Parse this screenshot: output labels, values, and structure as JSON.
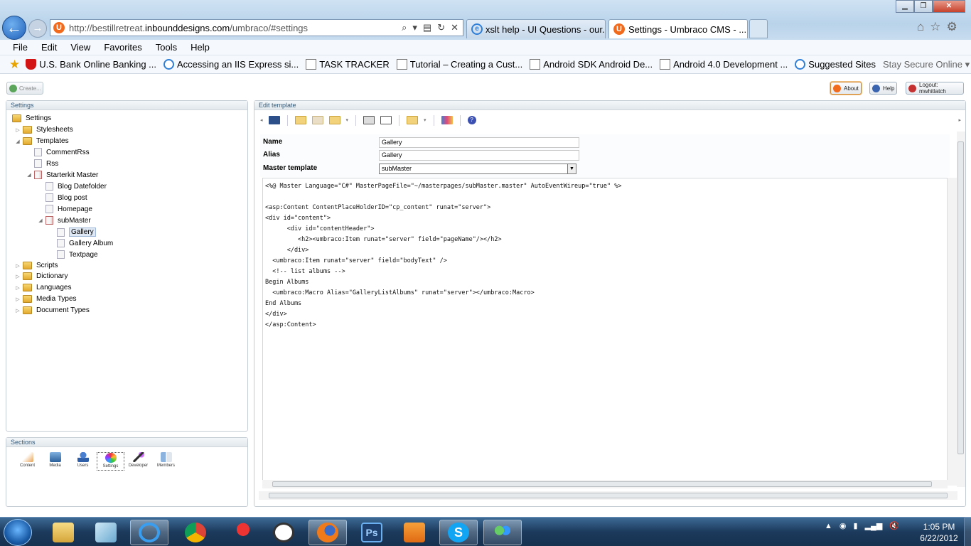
{
  "browser": {
    "address": {
      "prefix": "http://bestillretreat.",
      "domain": "inbounddesigns.com",
      "path": "/umbraco/#settings"
    },
    "tabs": [
      {
        "label": "xslt help - UI Questions - our.u..."
      },
      {
        "label": "Settings - Umbraco CMS - ..."
      }
    ],
    "menu": [
      "File",
      "Edit",
      "View",
      "Favorites",
      "Tools",
      "Help"
    ],
    "favorites": [
      "U.S. Bank Online Banking ...",
      "Accessing an IIS Express si...",
      "TASK TRACKER",
      "Tutorial – Creating a Cust...",
      "Android SDK  Android De...",
      "Android 4.0 Development ...",
      "Suggested Sites",
      "Stay Secure Online"
    ]
  },
  "umbraco": {
    "create_label": "Create...",
    "about_label": "About",
    "help_label": "Help",
    "logout_label": "Logout: mwhitlatch",
    "settings_title": "Settings",
    "sections_title": "Sections",
    "edit_title": "Edit template",
    "tree": {
      "root": "Settings",
      "stylesheets": "Stylesheets",
      "templates": "Templates",
      "commentrss": "CommentRss",
      "rss": "Rss",
      "starterkit": "Starterkit Master",
      "blog_datefolder": "Blog Datefolder",
      "blog_post": "Blog post",
      "homepage": "Homepage",
      "submaster": "subMaster",
      "gallery": "Gallery",
      "gallery_album": "Gallery Album",
      "textpage": "Textpage",
      "scripts": "Scripts",
      "dictionary": "Dictionary",
      "languages": "Languages",
      "media_types": "Media Types",
      "document_types": "Document Types"
    },
    "sections": [
      "Content",
      "Media",
      "Users",
      "Settings",
      "Developer",
      "Members"
    ],
    "form": {
      "name_label": "Name",
      "name_value": "Gallery",
      "alias_label": "Alias",
      "alias_value": "Gallery",
      "master_label": "Master template",
      "master_value": "subMaster"
    },
    "code": "<%@ Master Language=\"C#\" MasterPageFile=\"~/masterpages/subMaster.master\" AutoEventWireup=\"true\" %>\n\n<asp:Content ContentPlaceHolderID=\"cp_content\" runat=\"server\">\n<div id=\"content\">\n      <div id=\"contentHeader\">\n         <h2><umbraco:Item runat=\"server\" field=\"pageName\"/></h2>\n      </div>\n  <umbraco:Item runat=\"server\" field=\"bodyText\" />\n  <!-- list albums -->\nBegin Albums\n  <umbraco:Macro Alias=\"GalleryListAlbums\" runat=\"server\"></umbraco:Macro>\nEnd Albums\n</div>\n</asp:Content>"
  },
  "taskbar": {
    "time": "1:05 PM",
    "date": "6/22/2012"
  },
  "colors": {
    "accent": "#f26b1d",
    "ie_blue": "#2f7fd8",
    "taskbar": "#1c3a5c"
  }
}
